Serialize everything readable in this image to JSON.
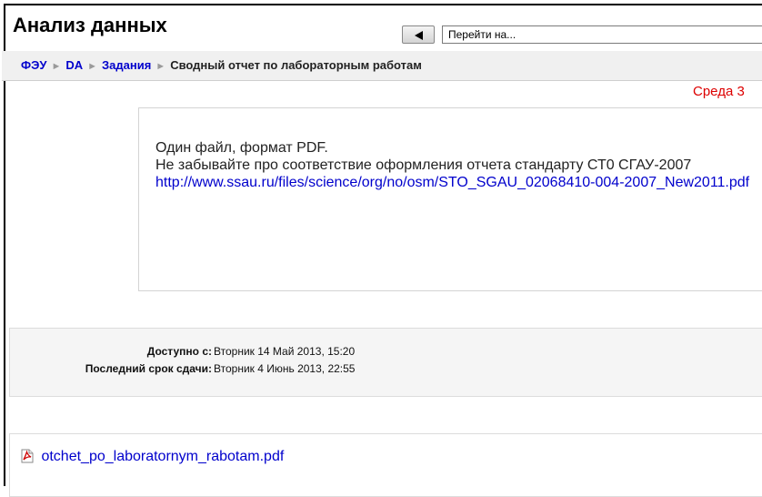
{
  "header": {
    "title": "Анализ данных",
    "jump_placeholder": "Перейти на..."
  },
  "breadcrumb": {
    "items": [
      "ФЭУ",
      "DA",
      "Задания"
    ],
    "current": "Сводный отчет по лабораторным работам"
  },
  "date_line": "Среда 3",
  "intro": {
    "line1": "Один файл, формат PDF.",
    "line2": "Не забывайте про соответствие оформления отчета стандарту СТ0 СГАУ-2007",
    "link_text": "http://www.ssau.ru/files/science/org/no/osm/STO_SGAU_02068410-004-2007_New2011.pdf"
  },
  "dates": {
    "available_label": "Доступно с:",
    "available_value": "Вторник 14 Май 2013, 15:20",
    "due_label": "Последний срок сдачи:",
    "due_value": "Вторник 4 Июнь 2013, 22:55"
  },
  "attachment": {
    "icon": "pdf-icon",
    "filename": "otchet_po_laboratornym_rabotam.pdf"
  },
  "colors": {
    "link": "#0000cc",
    "date_red": "#dd0000",
    "bar_bg": "#f0f0f0"
  }
}
